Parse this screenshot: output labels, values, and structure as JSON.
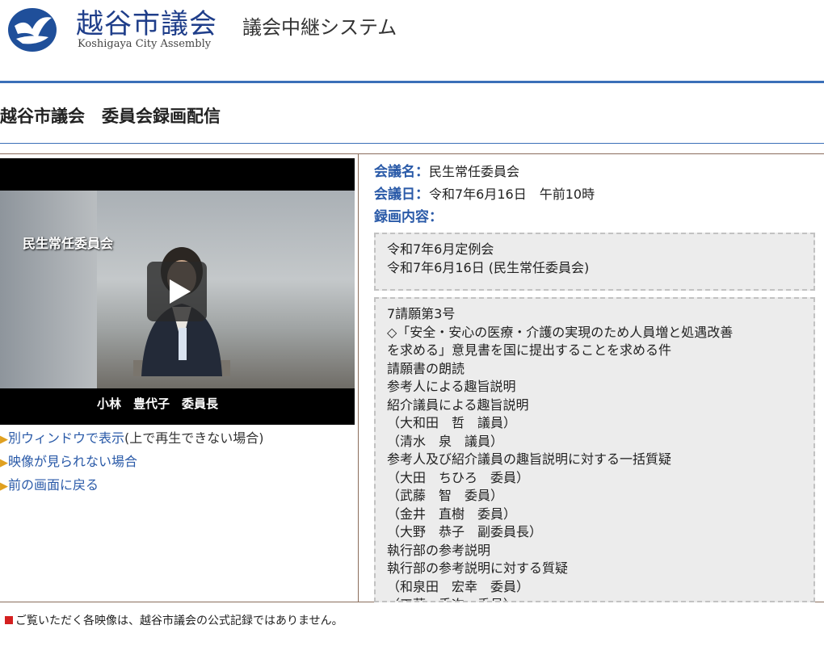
{
  "header": {
    "title": "越谷市議会",
    "subtitle": "議会中継システム",
    "english": "Koshigaya City Assembly"
  },
  "page_title": "越谷市議会　委員会録画配信",
  "video": {
    "caption": "民生常任委員会",
    "speaker_name": "小林　豊代子　委員長"
  },
  "links": [
    {
      "label": "別ウィンドウで表示",
      "note": "(上で再生できない場合)"
    },
    {
      "label": "映像が見られない場合",
      "note": ""
    },
    {
      "label": "前の画面に戻る",
      "note": ""
    }
  ],
  "info": {
    "meeting_label": "会議名：",
    "meeting_value": "民生常任委員会",
    "date_label": "会議日：",
    "date_value": "令和7年6月16日　午前10時",
    "content_label": "録画内容："
  },
  "session_box": [
    "令和7年6月定例会",
    "令和7年6月16日 (民生常任委員会)"
  ],
  "agenda_box": [
    "7請願第3号",
    "◇「安全・安心の医療・介護の実現のため人員増と処遇改善",
    "を求める」意見書を国に提出することを求める件",
    "請願書の朗読",
    "参考人による趣旨説明",
    "紹介議員による趣旨説明",
    "（大和田　哲　議員）",
    "（清水　泉　議員）",
    "参考人及び紹介議員の趣旨説明に対する一括質疑",
    "（大田　ちひろ　委員）",
    "（武藤　智　委員）",
    "（金井　直樹　委員）",
    "（大野　恭子　副委員長）",
    "執行部の参考説明",
    "執行部の参考説明に対する質疑",
    "（和泉田　宏幸　委員）",
    "（工藤　秀次　委員）"
  ],
  "footer": {
    "notice": "ご覧いただく各映像は、越谷市議会の公式記録ではありません。"
  },
  "colors": {
    "brand_blue": "#1f3e8a",
    "link_blue": "#2a5aa8",
    "rule_blue": "#3b6fb8",
    "notice_red": "#d42020"
  },
  "icons": [
    "logo-emblem-icon",
    "play-icon",
    "arrow-right-icon",
    "red-square-icon"
  ]
}
